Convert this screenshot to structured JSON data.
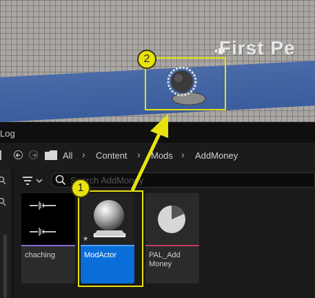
{
  "viewport": {
    "overlay_text": "First Pe"
  },
  "panel": {
    "tab_label": "Log"
  },
  "breadcrumbs": [
    "All",
    "Content",
    "Mods",
    "AddMoney"
  ],
  "search": {
    "placeholder": "Search AddMoney"
  },
  "assets": [
    {
      "name": "chaching",
      "type_color": "#8f6bd6",
      "selected": false
    },
    {
      "name": "ModActor",
      "type_color": "#4aa3ff",
      "selected": true
    },
    {
      "name": "PAL_Add Money",
      "type_color": "#c33b5c",
      "selected": false
    }
  ],
  "callouts": [
    {
      "number": "1",
      "color": "#e8e20f"
    },
    {
      "number": "2",
      "color": "#e8e20f"
    }
  ]
}
